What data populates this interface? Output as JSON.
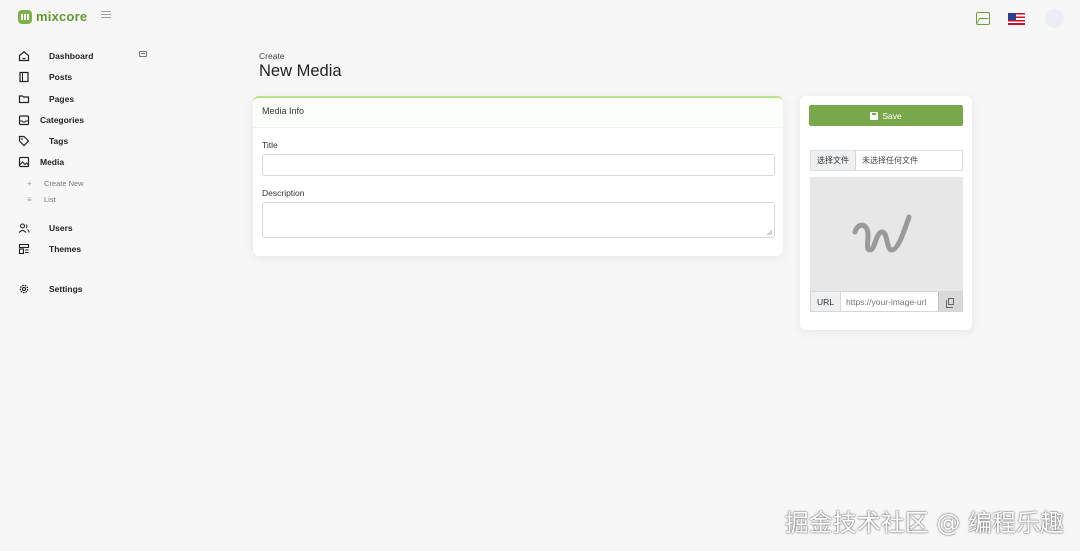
{
  "app": {
    "name": "mixcore"
  },
  "sidebar": {
    "items": [
      {
        "label": "Dashboard",
        "icon": "home-icon"
      },
      {
        "label": "Posts",
        "icon": "book-icon"
      },
      {
        "label": "Pages",
        "icon": "folder-icon"
      },
      {
        "label": "Categories",
        "icon": "inbox-icon"
      },
      {
        "label": "Tags",
        "icon": "tag-icon"
      },
      {
        "label": "Media",
        "icon": "image-icon"
      },
      {
        "label": "Users",
        "icon": "users-icon"
      },
      {
        "label": "Themes",
        "icon": "layout-icon"
      },
      {
        "label": "Settings",
        "icon": "gear-icon"
      }
    ],
    "media_sub": [
      {
        "label": "Create New",
        "icon": "plus-icon"
      },
      {
        "label": "List",
        "icon": "list-icon"
      }
    ]
  },
  "header": {
    "breadcrumb": "Create",
    "title": "New Media",
    "accent_color": "#78a84a"
  },
  "main": {
    "card_title": "Media Info",
    "title_label": "Title",
    "title_value": "",
    "description_label": "Description",
    "description_value": ""
  },
  "side": {
    "save_label": "Save",
    "file_button": "选择文件",
    "file_status": "未选择任何文件",
    "url_label": "URL",
    "url_placeholder": "https://your-image-url"
  },
  "watermark": "掘金技术社区 @ 编程乐趣"
}
